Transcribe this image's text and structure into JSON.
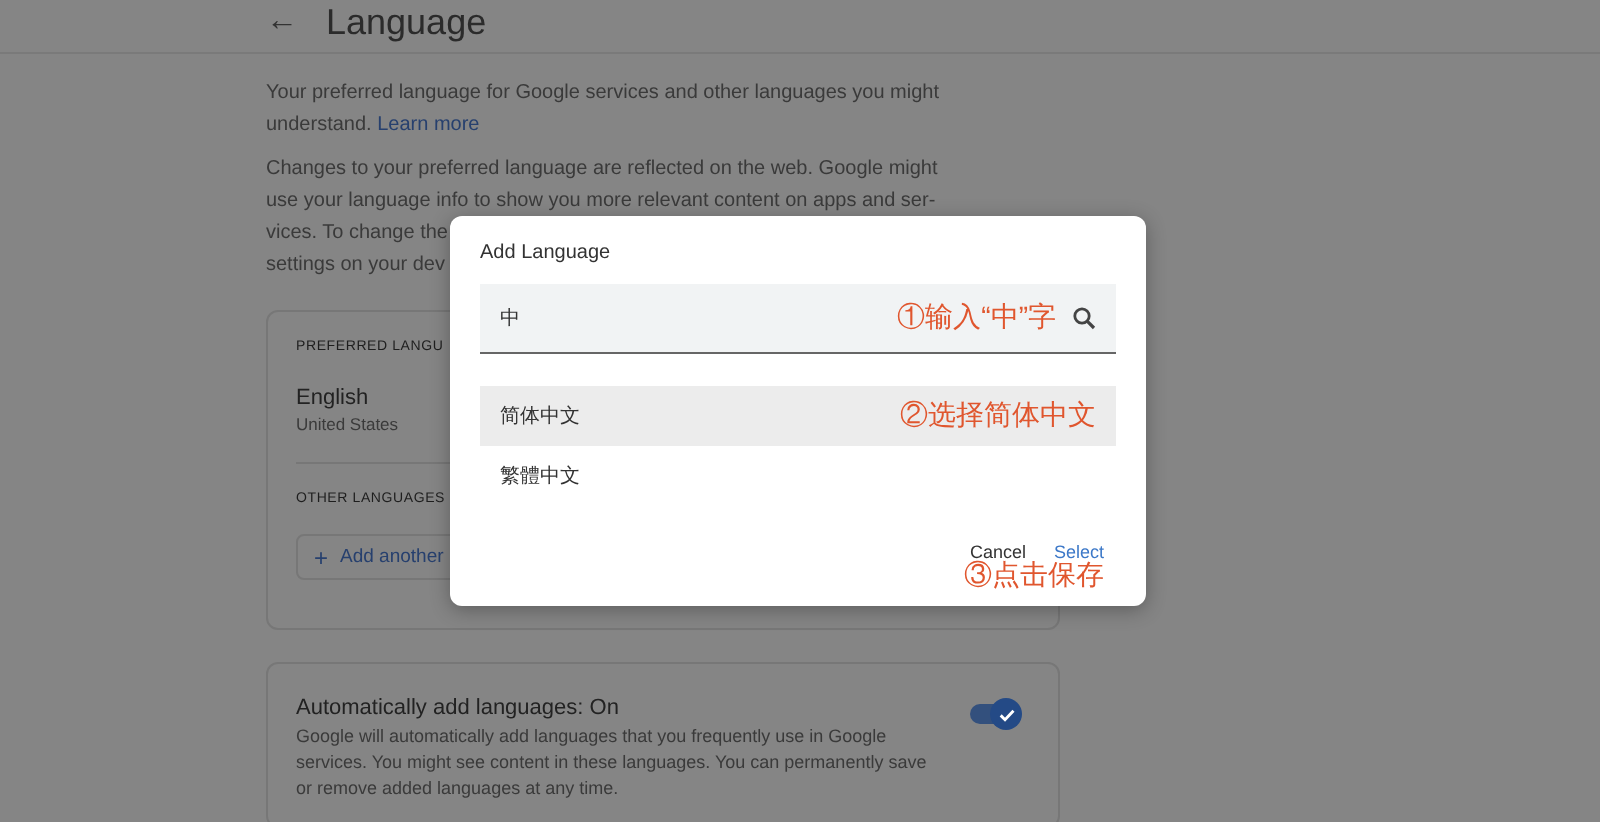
{
  "header": {
    "back_icon": "←",
    "title": "Language"
  },
  "intro": {
    "text": "Your preferred language for Google services and other languages you might understand.",
    "link": "Learn more"
  },
  "notice_lines": [
    "Changes to your preferred language are reflected on the web. Google might",
    "use your language info to show you more relevant content on apps and ser-",
    "vices. To change the",
    "settings on your dev"
  ],
  "languages_card": {
    "preferred_heading": "PREFERRED LANGU",
    "preferred": {
      "name": "English",
      "region": "United States"
    },
    "other_heading": "OTHER LANGUAGES",
    "add_icon": "+",
    "add_button": "Add another"
  },
  "auto_card": {
    "title": "Automatically add languages: On",
    "on": true,
    "description": "Google will automatically add languages that you frequently use in Google services. You might see content in these languages. You can permanently save or remove added languages at any time."
  },
  "dialog": {
    "title": "Add Language",
    "search": {
      "value": "中",
      "annotation": "①输入“中”字"
    },
    "results": [
      {
        "label": "简体中文",
        "selected": true,
        "annotation": "②选择简体中文"
      },
      {
        "label": "繁體中文",
        "selected": false
      }
    ],
    "buttons": [
      {
        "label": "Cancel",
        "kind": "text"
      },
      {
        "label": "Select",
        "kind": "primary"
      }
    ],
    "button_annotation": "③点击保存"
  }
}
